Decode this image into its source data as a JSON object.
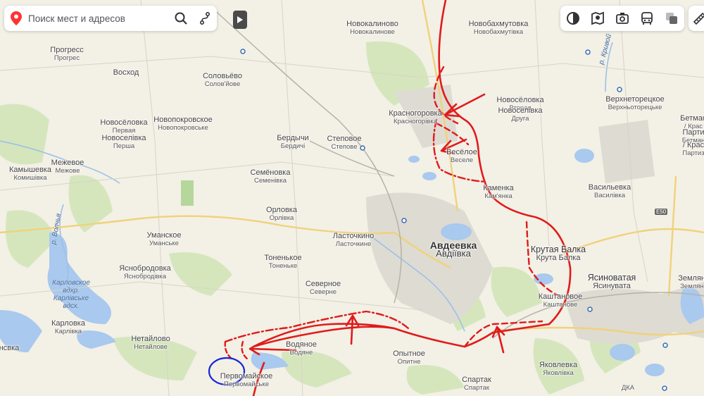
{
  "search": {
    "placeholder": "Поиск мест и адресов"
  },
  "toolbar": {
    "icons": [
      "layers-icon",
      "panorama-icon",
      "camera-icon",
      "transport-icon",
      "traffic-icon"
    ]
  },
  "water_labels": {
    "reservoir_1": "Карловское",
    "reservoir_2": "вдхр.",
    "reservoir_3": "Карлівське",
    "reservoir_4": "вдсх.",
    "river_volchya": "р. Волчья",
    "river_krivoy": "р. Кривой"
  },
  "road_label": "E50",
  "settlements": [
    {
      "id": "novokalinovo",
      "p": "Новокалиново",
      "s": "Новокалинове"
    },
    {
      "id": "novobakhmutovka",
      "p": "Новобахмутовка",
      "s": "Новобахмутівка"
    },
    {
      "id": "progress",
      "p": "Прогресс",
      "s": "Прогрес"
    },
    {
      "id": "voskhod",
      "p": "Восход",
      "s": ""
    },
    {
      "id": "solovyovo",
      "p": "Соловьёво",
      "s": "Солов'йове"
    },
    {
      "id": "novoselovka1",
      "p": "Новосёловка",
      "s": "Первая"
    },
    {
      "id": "novoselovka1b",
      "p": "Новоселівка",
      "s": "Перша"
    },
    {
      "id": "novopokrovskoe",
      "p": "Новопокровское",
      "s": "Новопокровське"
    },
    {
      "id": "berdychi",
      "p": "Бердычи",
      "s": "Бердичі"
    },
    {
      "id": "stepovoe",
      "p": "Степовое",
      "s": "Степове"
    },
    {
      "id": "krasnogorovka",
      "p": "Красногоровка",
      "s": "Красногорівка"
    },
    {
      "id": "novoselovka2",
      "p": "Новосёловка",
      "s": "Вторая"
    },
    {
      "id": "novoselovka2b",
      "p": "Новоселівка",
      "s": "Друга"
    },
    {
      "id": "verkhnetoretskoe",
      "p": "Верхнеторецкое",
      "s": "Верхньоторецьке"
    },
    {
      "id": "betmanovo",
      "p": "Бетман",
      "s": "/ Крас"
    },
    {
      "id": "betmanovo2",
      "p": "Парти",
      "s": "Бетман"
    },
    {
      "id": "betmanovo3",
      "p": "/ Крас",
      "s": "Партиз"
    },
    {
      "id": "veseloe",
      "p": "Весёлое",
      "s": "Веселе"
    },
    {
      "id": "kamyshevka",
      "p": "Камышевка",
      "s": "Комишівка"
    },
    {
      "id": "mezhevoe",
      "p": "Межевое",
      "s": "Межове"
    },
    {
      "id": "semenovka",
      "p": "Семёновка",
      "s": "Семенівка"
    },
    {
      "id": "kamenka",
      "p": "Каменка",
      "s": "Кам'янка"
    },
    {
      "id": "vasilyevka",
      "p": "Васильевка",
      "s": "Василівка"
    },
    {
      "id": "orlovka",
      "p": "Орловка",
      "s": "Орлівка"
    },
    {
      "id": "umanskoe",
      "p": "Уманское",
      "s": "Уманське"
    },
    {
      "id": "lastochkino",
      "p": "Ласточкино",
      "s": "Ласточкине"
    },
    {
      "id": "avdeevka",
      "p": "Авдеевка",
      "s": "Авдіївка"
    },
    {
      "id": "krutaya_balka",
      "p": "Крутая Балка",
      "s": "Крута Балка"
    },
    {
      "id": "yasnobrodovka",
      "p": "Яснобродовка",
      "s": "Яснобродівка"
    },
    {
      "id": "tonenkoe",
      "p": "Тоненькое",
      "s": "Тоненьке"
    },
    {
      "id": "yasinovataya",
      "p": "Ясиноватая",
      "s": "Ясинувата"
    },
    {
      "id": "zemlyanki",
      "p": "Землянк",
      "s": "Землянк"
    },
    {
      "id": "severnoe",
      "p": "Северное",
      "s": "Северне"
    },
    {
      "id": "kashtanovoe",
      "p": "Каштановое",
      "s": "Каштанове"
    },
    {
      "id": "karlovka",
      "p": "Карловка",
      "s": "Карлівка"
    },
    {
      "id": "netaylovo",
      "p": "Нетайлово",
      "s": "Нетайлове"
    },
    {
      "id": "vodyanoe",
      "p": "Водяное",
      "s": "Водяне"
    },
    {
      "id": "opytnoe",
      "p": "Опытное",
      "s": "Опитне"
    },
    {
      "id": "yakovlevka",
      "p": "Яковлевка",
      "s": "Яковлівка"
    },
    {
      "id": "pervomayskoe",
      "p": "Первомайское",
      "s": "Первомайське"
    },
    {
      "id": "spartak",
      "p": "Спартак",
      "s": "Спартак"
    },
    {
      "id": "dka",
      "p": "",
      "s": "ДКА"
    },
    {
      "id": "novka",
      "p": "нсвка",
      "s": ""
    }
  ],
  "colors": {
    "front_line": "#e01b1b",
    "highlight_circle": "#1726d6",
    "water": "#a9c9ee",
    "forest": "#cfe3b5",
    "urban": "#dcdad3"
  }
}
